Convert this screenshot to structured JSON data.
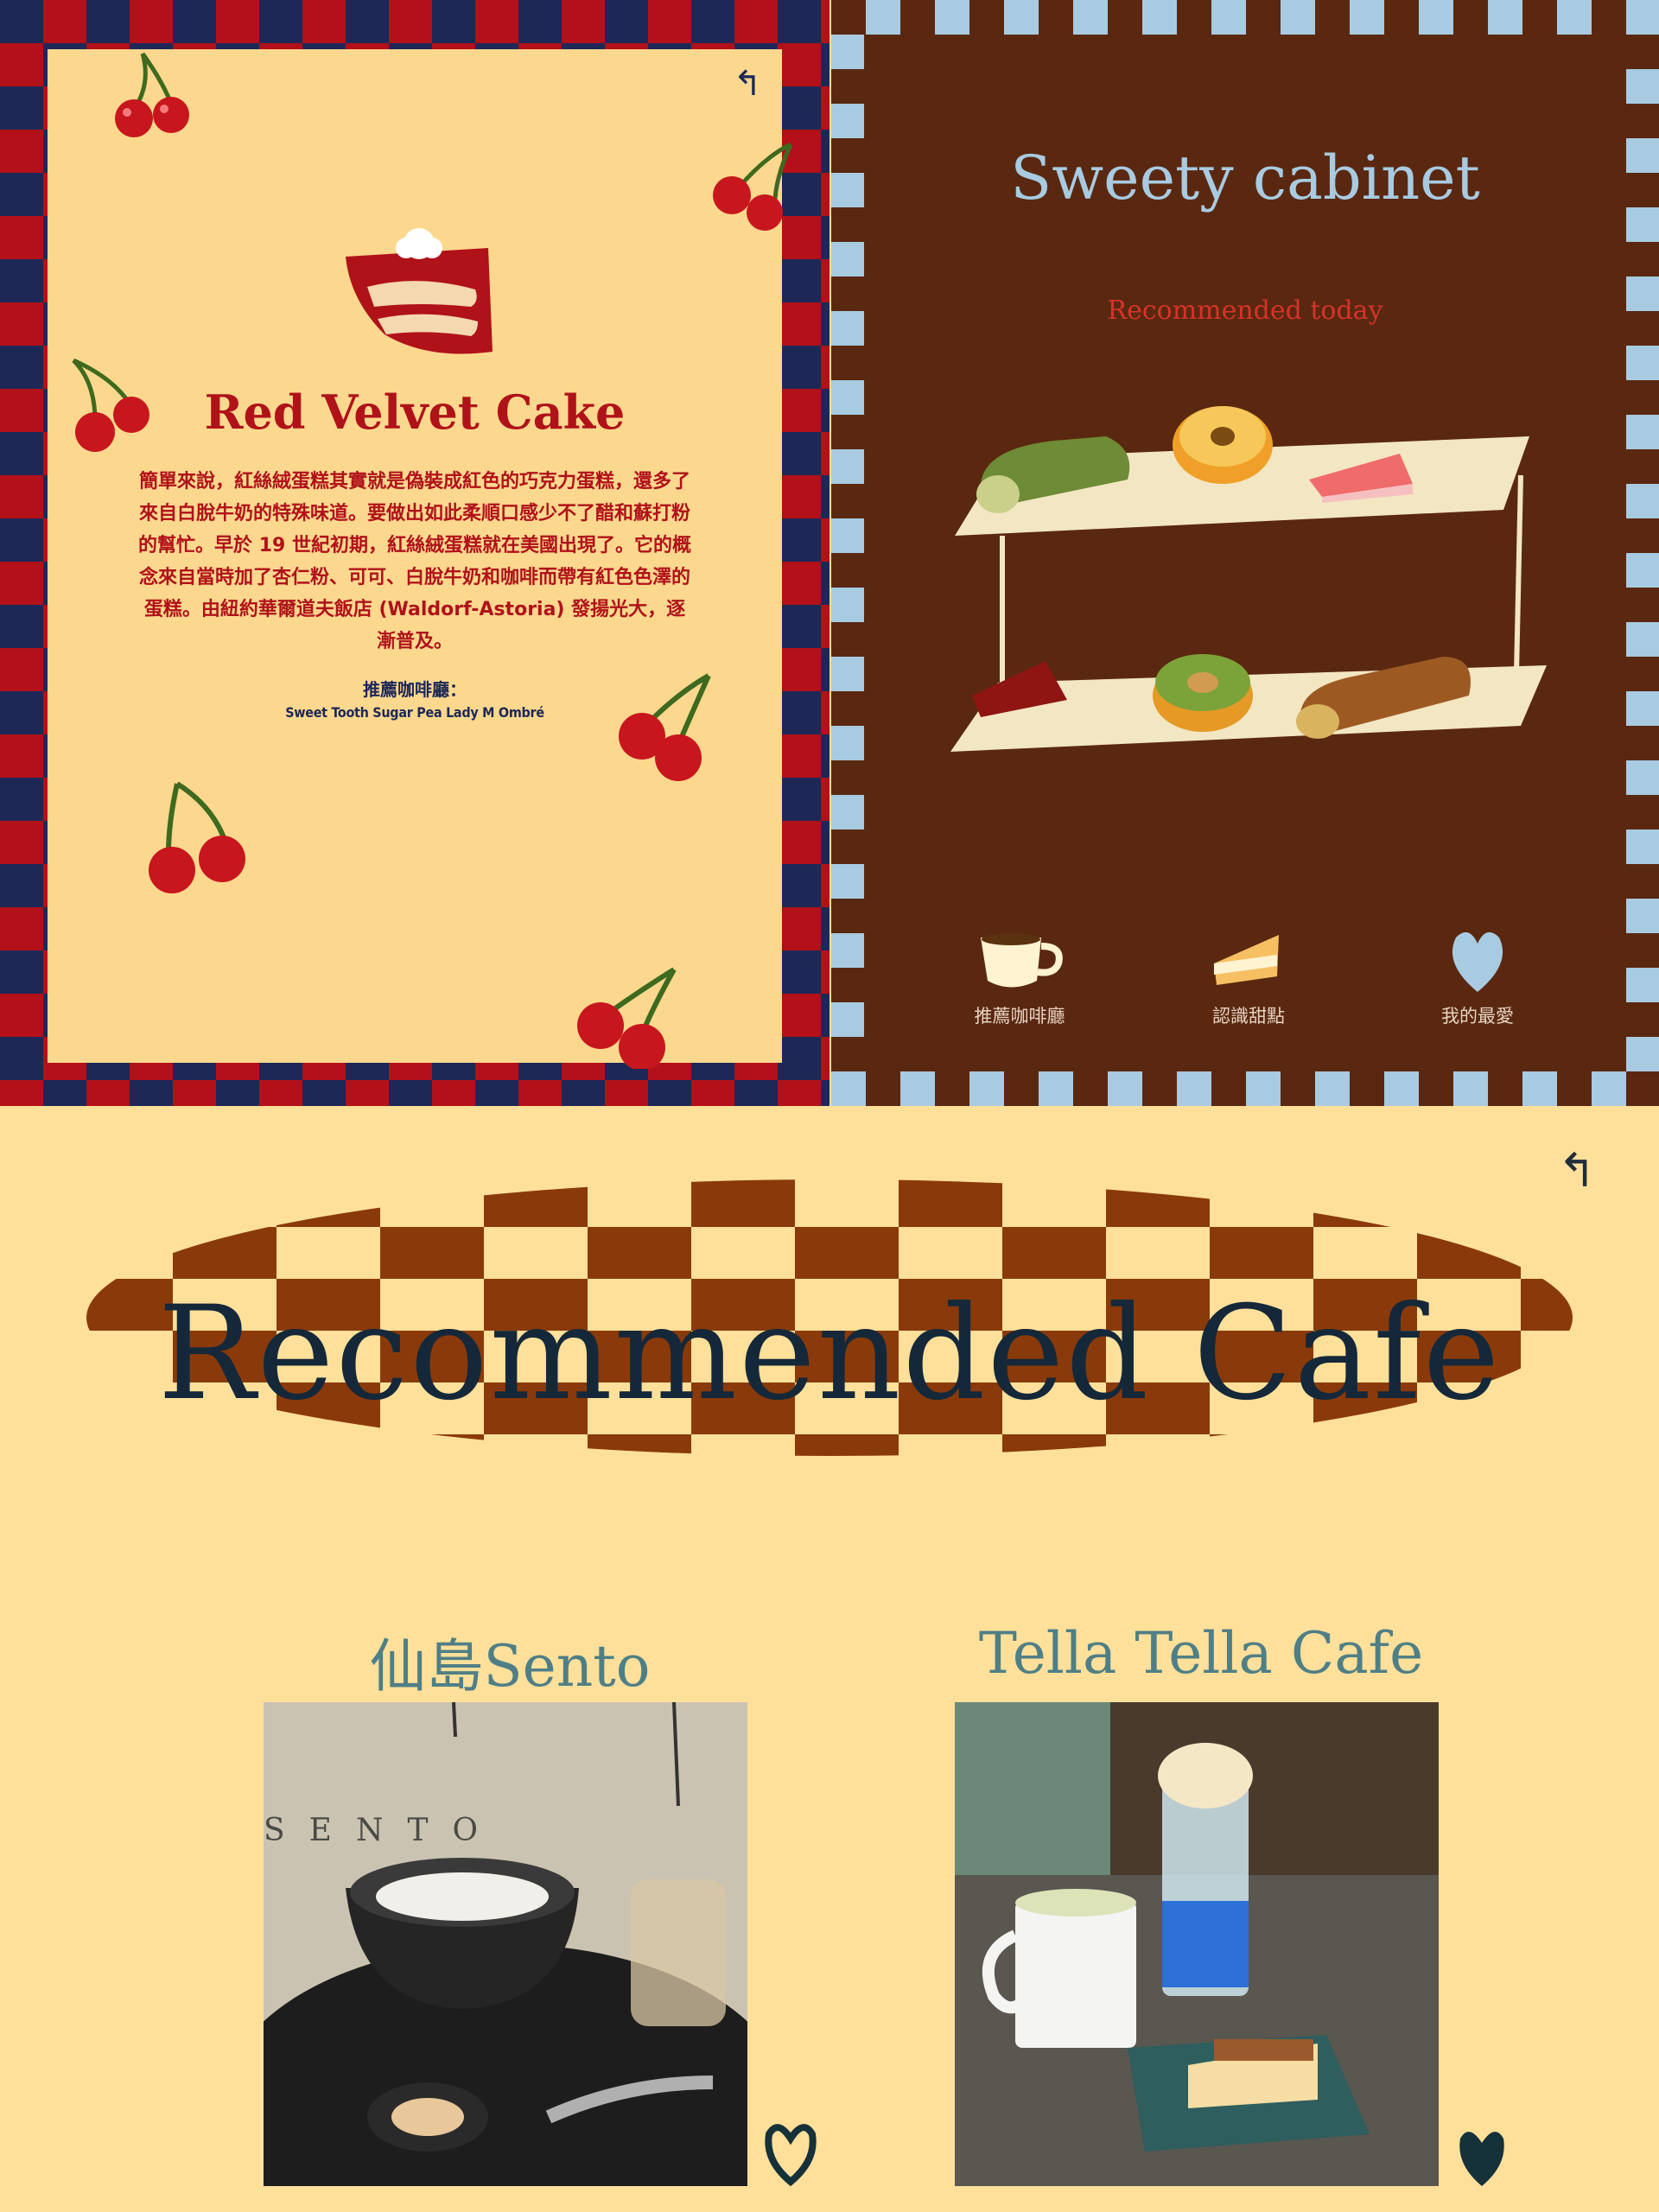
{
  "cake_page": {
    "title": "Red Velvet Cake",
    "description": "簡單來說，紅絲絨蛋糕其實就是偽裝成紅色的巧克力蛋糕，還多了來自白脫牛奶的特殊味道。要做出如此柔順口感少不了醋和蘇打粉的幫忙。早於 19 世紀初期，紅絲絨蛋糕就在美國出現了。它的概念來自當時加了杏仁粉、可可、白脫牛奶和咖啡而帶有紅色色澤的蛋糕。由紐約華爾道夫飯店 (Waldorf-Astoria) 發揚光大，逐漸普及。",
    "cafe_heading": "推薦咖啡廳：",
    "cafe_list": "Sweet Tooth  Sugar Pea  Lady M  Ombré",
    "back_icon": "↰",
    "colors": {
      "card": "#FCD88E",
      "red": "#B0121A",
      "navy": "#1D2857"
    }
  },
  "home_page": {
    "title": "Sweety cabinet",
    "subtitle": "Recommended today",
    "nav": [
      {
        "label": "推薦咖啡廳",
        "icon": "coffee-cup-icon"
      },
      {
        "label": "認識甜點",
        "icon": "cake-slice-icon"
      },
      {
        "label": "我的最愛",
        "icon": "heart-icon"
      }
    ],
    "colors": {
      "bg": "#5A2810",
      "blue": "#A8CBE2",
      "accent": "#D6332A"
    }
  },
  "cafe_page": {
    "title": "Recommended Cafe",
    "back_icon": "↰",
    "cafes": [
      {
        "name": "仙島Sento",
        "photo_text": "SENTO",
        "favorite": false
      },
      {
        "name": "Tella Tella Cafe",
        "favorite": true
      }
    ],
    "colors": {
      "bg": "#FFE09A",
      "brown": "#8A3A0A",
      "teal": "#4F7F86",
      "dark": "#14283A"
    }
  }
}
